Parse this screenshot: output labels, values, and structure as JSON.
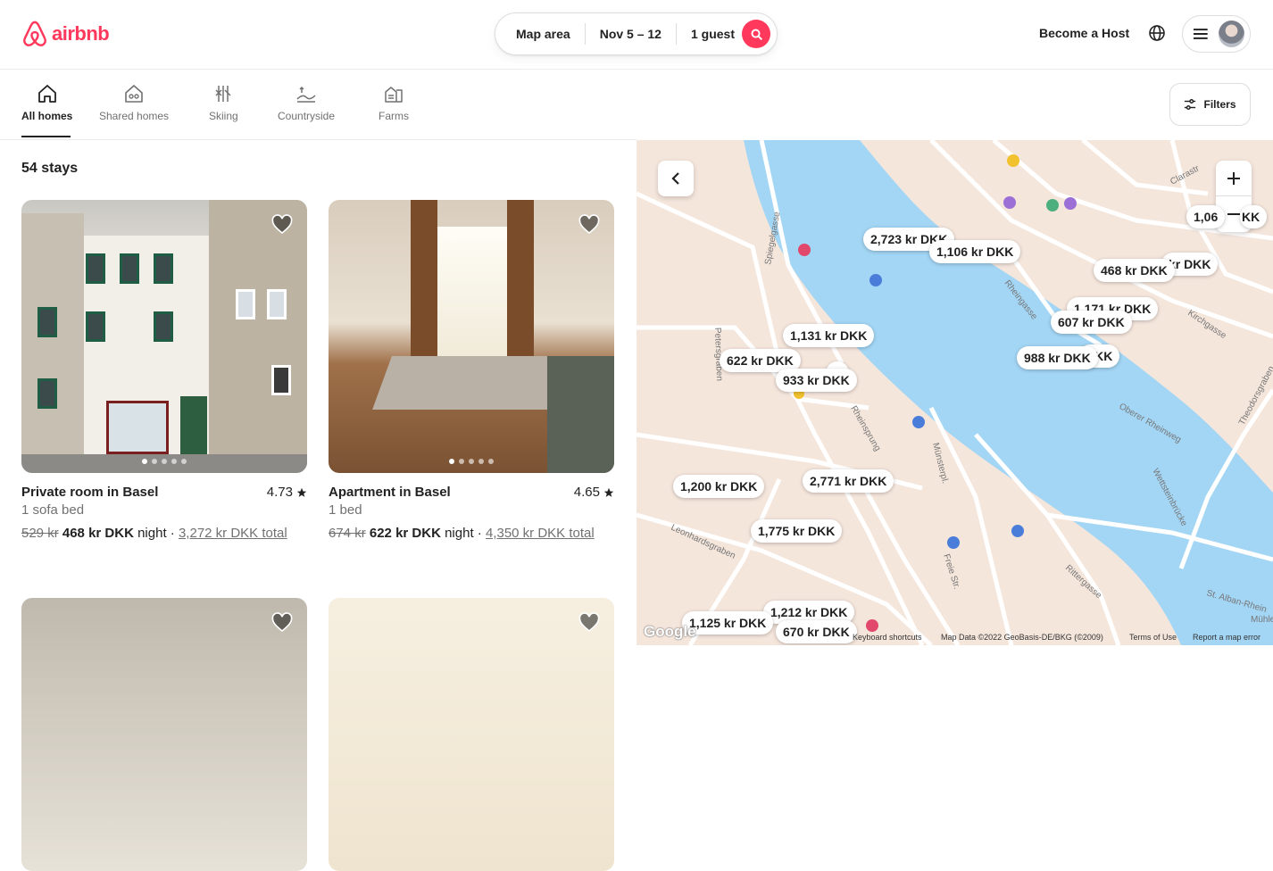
{
  "brand": {
    "name": "airbnb",
    "color": "#FF385C"
  },
  "search": {
    "location": "Map area",
    "dates": "Nov 5 – 12",
    "guests": "1 guest"
  },
  "header": {
    "host_link": "Become a Host"
  },
  "categories": [
    {
      "label": "All homes",
      "icon": "home-icon",
      "active": true
    },
    {
      "label": "Shared homes",
      "icon": "shared-homes-icon",
      "active": false
    },
    {
      "label": "Skiing",
      "icon": "skiing-icon",
      "active": false
    },
    {
      "label": "Countryside",
      "icon": "countryside-icon",
      "active": false
    },
    {
      "label": "Farms",
      "icon": "farm-icon",
      "active": false
    }
  ],
  "filters_label": "Filters",
  "results": {
    "count_label": "54 stays"
  },
  "listings": [
    {
      "title": "Private room in Basel",
      "subtitle": "1 sofa bed",
      "rating": "4.73",
      "orig_price": "529 kr",
      "price": "468 kr DKK",
      "night": "night",
      "total": "3,272 kr DKK total"
    },
    {
      "title": "Apartment in Basel",
      "subtitle": "1 bed",
      "rating": "4.65",
      "orig_price": "674 kr",
      "price": "622 kr DKK",
      "night": "night",
      "total": "4,350 kr DKK total"
    }
  ],
  "map": {
    "pins": [
      "2,723 kr DKK",
      "1,106 kr DKK",
      "468 kr DKK",
      "kr DKK",
      "1,06",
      "KK",
      "1,171 kr DKK",
      "607 kr DKK",
      "1,131 kr DKK",
      "622 kr DKK",
      "K",
      "933 kr DKK",
      "DKK",
      "988 kr DKK",
      "1,200 kr DKK",
      "2,771 kr DKK",
      "1,775 kr DKK",
      "1,212 kr DKK",
      "1,125 kr DKK",
      "670 kr DKK"
    ],
    "streets": [
      "Petersgraben",
      "Spiegelgasse",
      "Rheinsprung",
      "Leonhardsgraben",
      "Münsterpl.",
      "Freie Str.",
      "Rheingasse",
      "Kirchgasse",
      "Oberer Rheinweg",
      "Wettsteinbrücke",
      "Rittergasse",
      "St. Alban-Rhein",
      "Mühlenb",
      "Theodorsgraben",
      "Clarastr"
    ],
    "footer": {
      "google": "Google",
      "shortcuts": "Keyboard shortcuts",
      "data": "Map Data ©2022 GeoBasis-DE/BKG (©2009)",
      "terms": "Terms of Use",
      "report": "Report a map error"
    },
    "river_color": "#a3d6f5",
    "land_color": "#f5e6dc"
  }
}
